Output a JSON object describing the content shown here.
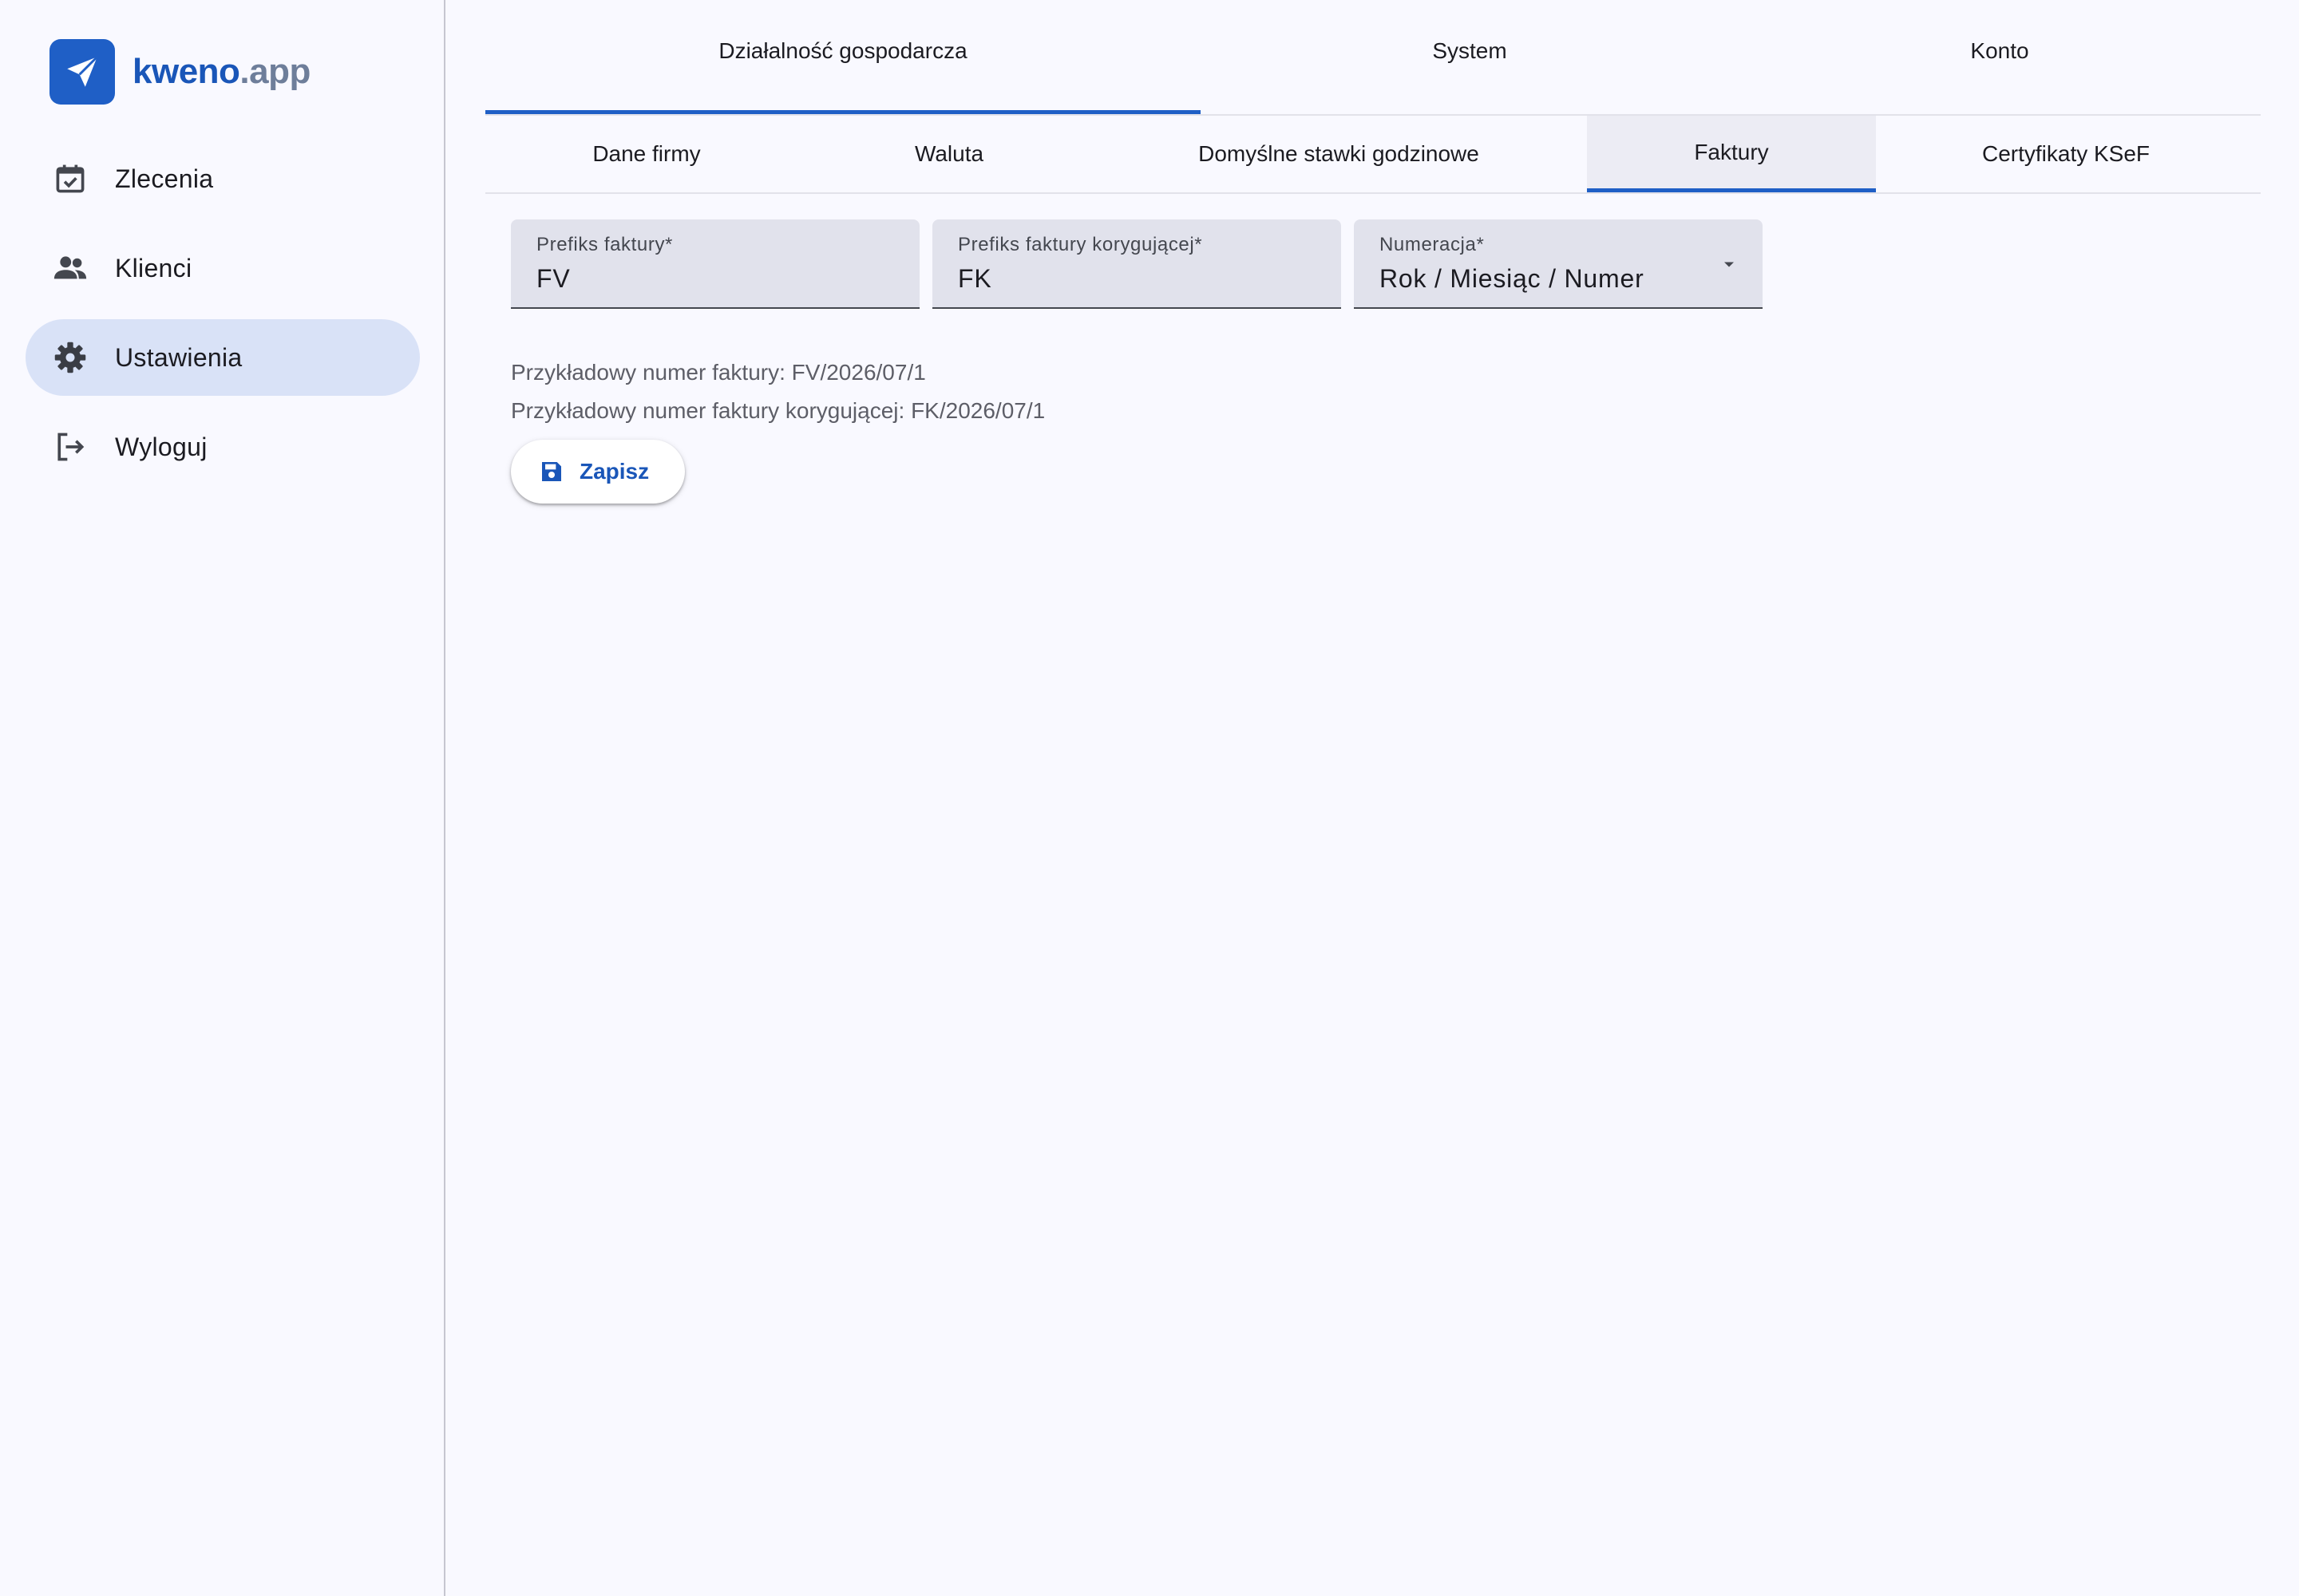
{
  "brand": {
    "name_primary": "kweno",
    "name_secondary": ".app",
    "logo_icon": "paper-plane-icon",
    "color": "#1f5fc6"
  },
  "sidebar": {
    "items": [
      {
        "label": "Zlecenia",
        "icon": "calendar-check-icon",
        "active": false
      },
      {
        "label": "Klienci",
        "icon": "people-icon",
        "active": false
      },
      {
        "label": "Ustawienia",
        "icon": "gear-icon",
        "active": true
      },
      {
        "label": "Wyloguj",
        "icon": "logout-icon",
        "active": false
      }
    ]
  },
  "main": {
    "tabs": [
      {
        "label": "Działalność gospodarcza",
        "active": true
      },
      {
        "label": "System",
        "active": false
      },
      {
        "label": "Konto",
        "active": false
      }
    ],
    "subtabs": [
      {
        "label": "Dane firmy",
        "active": false
      },
      {
        "label": "Waluta",
        "active": false
      },
      {
        "label": "Domyślne stawki godzinowe",
        "active": false
      },
      {
        "label": "Faktury",
        "active": true
      },
      {
        "label": "Certyfikaty KSeF",
        "active": false
      }
    ],
    "form": {
      "invoice_prefix": {
        "label": "Prefiks faktury*",
        "value": "FV"
      },
      "correction_prefix": {
        "label": "Prefiks faktury korygującej*",
        "value": "FK"
      },
      "numbering": {
        "label": "Numeracja*",
        "value": "Rok / Miesiąc / Numer"
      },
      "example_invoice": "Przykładowy numer faktury: FV/2026/07/1",
      "example_correction": "Przykładowy numer faktury korygującej: FK/2026/07/1",
      "save_label": "Zapisz"
    }
  },
  "colors": {
    "accent": "#1f5fc6",
    "active_nav_bg": "#d9e2f7",
    "field_bg": "#e1e2ec",
    "page_bg": "#f9f9ff"
  }
}
